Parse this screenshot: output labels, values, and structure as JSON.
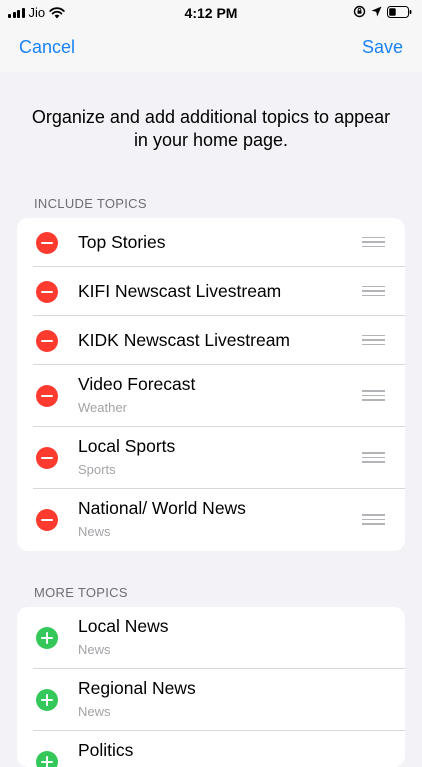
{
  "status_bar": {
    "carrier": "Jio",
    "time": "4:12 PM"
  },
  "nav": {
    "cancel_label": "Cancel",
    "save_label": "Save"
  },
  "intro_text": "Organize and add additional topics to appear in your home page.",
  "include_section": {
    "header": "INCLUDE TOPICS",
    "items": [
      {
        "title": "Top Stories",
        "subtitle": ""
      },
      {
        "title": "KIFI Newscast Livestream",
        "subtitle": ""
      },
      {
        "title": "KIDK Newscast Livestream",
        "subtitle": ""
      },
      {
        "title": "Video Forecast",
        "subtitle": "Weather"
      },
      {
        "title": "Local Sports",
        "subtitle": "Sports"
      },
      {
        "title": "National/ World News",
        "subtitle": "News"
      }
    ]
  },
  "more_section": {
    "header": "MORE TOPICS",
    "items": [
      {
        "title": "Local News",
        "subtitle": "News"
      },
      {
        "title": "Regional News",
        "subtitle": "News"
      },
      {
        "title": "Politics",
        "subtitle": ""
      }
    ]
  },
  "colors": {
    "accent": "#1a82f7",
    "remove": "#ff3b30",
    "add": "#34c759",
    "background": "#f2f2f7"
  },
  "icons": {
    "remove": "minus-circle-icon",
    "add": "plus-circle-icon",
    "reorder": "drag-handle-icon"
  }
}
